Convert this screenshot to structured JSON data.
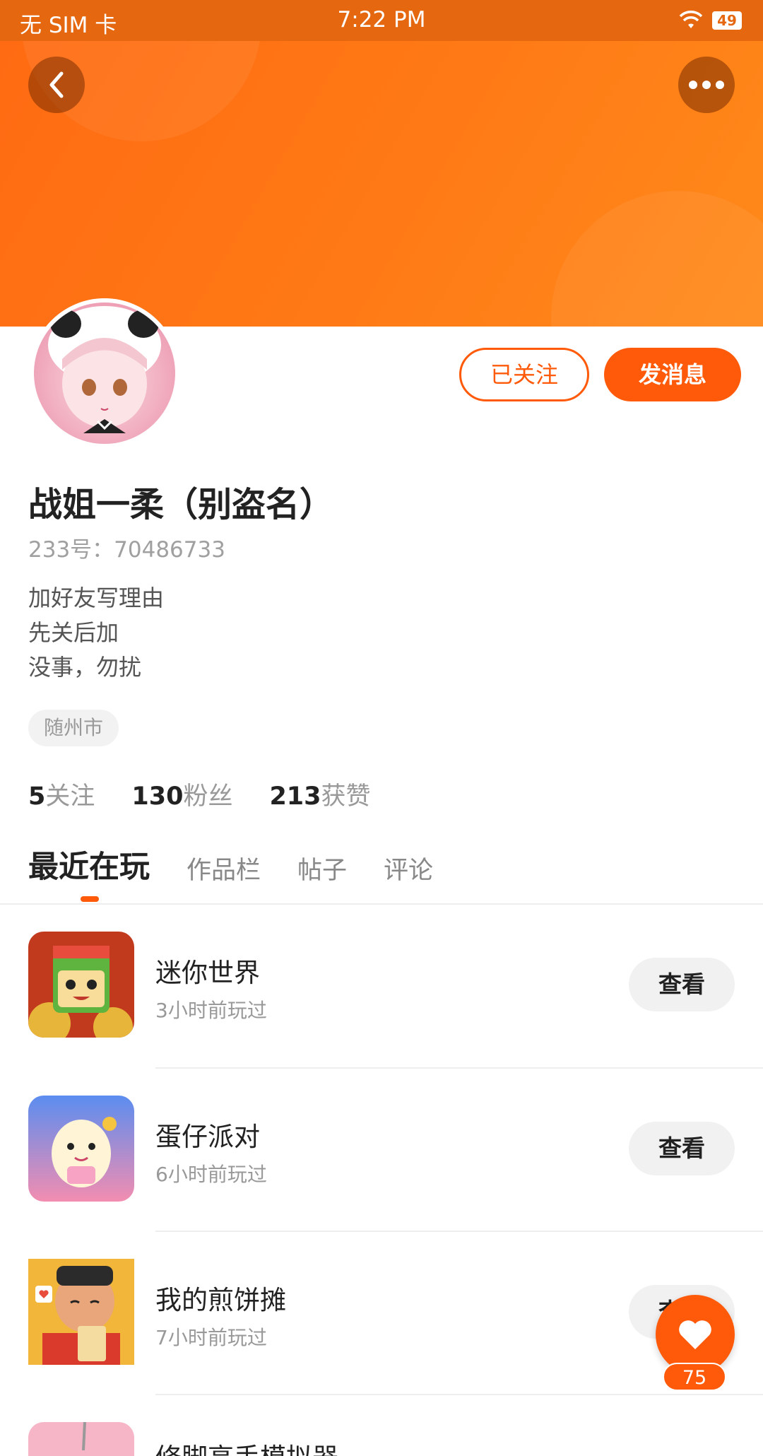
{
  "status_bar": {
    "carrier": "无 SIM 卡",
    "time": "7:22 PM",
    "battery": "49"
  },
  "profile": {
    "name": "战姐一柔（别盗名）",
    "id_text": "233号：70486733",
    "bio_lines": [
      "加好友写理由",
      "先关后加",
      "没事，勿扰"
    ],
    "location": "随州市",
    "followed_label": "已关注",
    "message_label": "发消息"
  },
  "stats": [
    {
      "num": "5",
      "label": "关注"
    },
    {
      "num": "130",
      "label": "粉丝"
    },
    {
      "num": "213",
      "label": "获赞"
    }
  ],
  "tabs": [
    {
      "label": "最近在玩",
      "active": true
    },
    {
      "label": "作品栏",
      "active": false
    },
    {
      "label": "帖子",
      "active": false
    },
    {
      "label": "评论",
      "active": false
    }
  ],
  "games": [
    {
      "name": "迷你世界",
      "time": "3小时前玩过",
      "button": "查看",
      "icon": "mini-world-icon"
    },
    {
      "name": "蛋仔派对",
      "time": "6小时前玩过",
      "button": "查看",
      "icon": "eggy-party-icon"
    },
    {
      "name": "我的煎饼摊",
      "time": "7小时前玩过",
      "button": "查看",
      "icon": "pancake-stall-icon"
    },
    {
      "name": "修脚高手模拟器",
      "time": "",
      "button": "",
      "icon": "pedicure-simulator-icon"
    }
  ],
  "like": {
    "count": "75"
  },
  "colors": {
    "accent": "#ff5a0a",
    "banner": "#ff7a16",
    "status_bar": "#e5670f"
  }
}
